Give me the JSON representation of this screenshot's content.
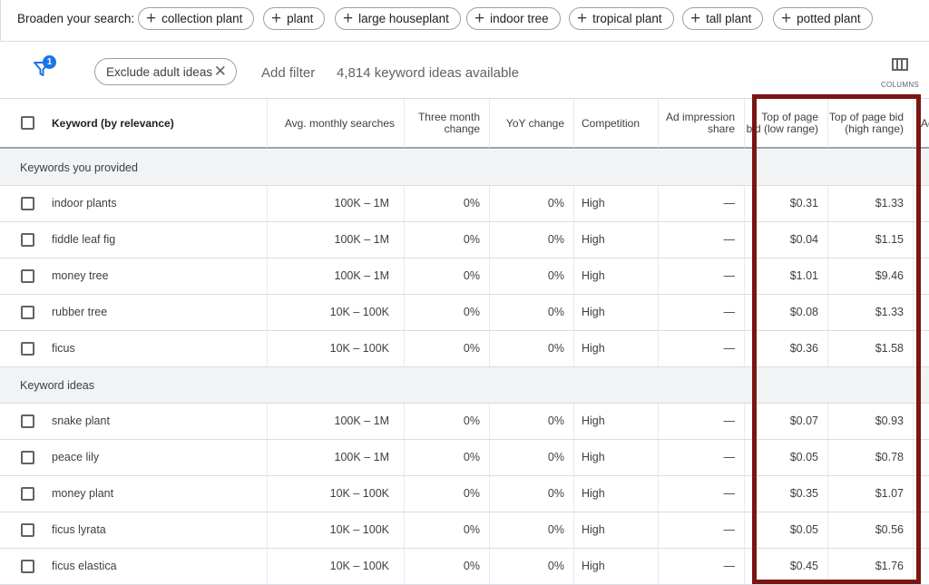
{
  "broaden": {
    "label": "Broaden your search:",
    "chips": [
      "collection plant",
      "plant",
      "large houseplant",
      "indoor tree",
      "tropical plant",
      "tall plant",
      "potted plant"
    ]
  },
  "filter": {
    "badge": "1",
    "exclude_label": "Exclude adult ideas",
    "add_filter": "Add filter",
    "count": "4,814 keyword ideas available",
    "columns_label": "COLUMNS"
  },
  "table": {
    "headers": {
      "keyword": "Keyword (by relevance)",
      "avg": "Avg. monthly searches",
      "three_month": "Three month change",
      "yoy": "YoY change",
      "competition": "Competition",
      "ad_impression": "Ad impression share",
      "bid_low": "Top of page bid (low range)",
      "bid_high": "Top of page bid (high range)",
      "extra": "Ac"
    },
    "sections": [
      {
        "title": "Keywords you provided",
        "rows": [
          {
            "keyword": "indoor plants",
            "avg": "100K – 1M",
            "three_month": "0%",
            "yoy": "0%",
            "competition": "High",
            "ad": "—",
            "low": "$0.31",
            "high": "$1.33"
          },
          {
            "keyword": "fiddle leaf fig",
            "avg": "100K – 1M",
            "three_month": "0%",
            "yoy": "0%",
            "competition": "High",
            "ad": "—",
            "low": "$0.04",
            "high": "$1.15"
          },
          {
            "keyword": "money tree",
            "avg": "100K – 1M",
            "three_month": "0%",
            "yoy": "0%",
            "competition": "High",
            "ad": "—",
            "low": "$1.01",
            "high": "$9.46"
          },
          {
            "keyword": "rubber tree",
            "avg": "10K – 100K",
            "three_month": "0%",
            "yoy": "0%",
            "competition": "High",
            "ad": "—",
            "low": "$0.08",
            "high": "$1.33"
          },
          {
            "keyword": "ficus",
            "avg": "10K – 100K",
            "three_month": "0%",
            "yoy": "0%",
            "competition": "High",
            "ad": "—",
            "low": "$0.36",
            "high": "$1.58"
          }
        ]
      },
      {
        "title": "Keyword ideas",
        "rows": [
          {
            "keyword": "snake plant",
            "avg": "100K – 1M",
            "three_month": "0%",
            "yoy": "0%",
            "competition": "High",
            "ad": "—",
            "low": "$0.07",
            "high": "$0.93"
          },
          {
            "keyword": "peace lily",
            "avg": "100K – 1M",
            "three_month": "0%",
            "yoy": "0%",
            "competition": "High",
            "ad": "—",
            "low": "$0.05",
            "high": "$0.78"
          },
          {
            "keyword": "money plant",
            "avg": "10K – 100K",
            "three_month": "0%",
            "yoy": "0%",
            "competition": "High",
            "ad": "—",
            "low": "$0.35",
            "high": "$1.07"
          },
          {
            "keyword": "ficus lyrata",
            "avg": "10K – 100K",
            "three_month": "0%",
            "yoy": "0%",
            "competition": "High",
            "ad": "—",
            "low": "$0.05",
            "high": "$0.56"
          },
          {
            "keyword": "ficus elastica",
            "avg": "10K – 100K",
            "three_month": "0%",
            "yoy": "0%",
            "competition": "High",
            "ad": "—",
            "low": "$0.45",
            "high": "$1.76"
          }
        ]
      }
    ]
  },
  "colors": {
    "accent": "#1a73e8",
    "highlight": "#7b1512"
  }
}
